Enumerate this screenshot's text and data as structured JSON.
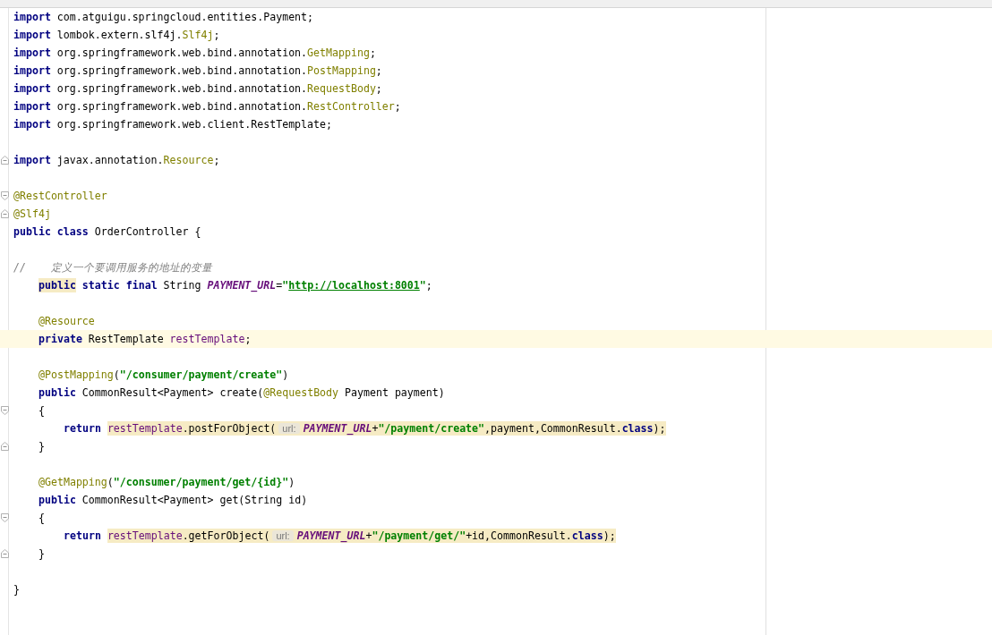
{
  "editor": {
    "lines": [
      {
        "kind": "top",
        "current": false,
        "fold_start": false,
        "fold_end": false,
        "tokens": [
          {
            "kind": "kw",
            "text": "import"
          },
          {
            "kind": "plain",
            "text": " com.atguigu.springcloud.entities.Payment;"
          }
        ]
      },
      {
        "kind": "top",
        "current": false,
        "fold_start": false,
        "fold_end": false,
        "tokens": [
          {
            "kind": "kw",
            "text": "import"
          },
          {
            "kind": "plain",
            "text": " lombok.extern.slf4j."
          },
          {
            "kind": "ann",
            "text": "Slf4j"
          },
          {
            "kind": "plain",
            "text": ";"
          }
        ]
      },
      {
        "kind": "top",
        "current": false,
        "fold_start": false,
        "fold_end": false,
        "tokens": [
          {
            "kind": "kw",
            "text": "import"
          },
          {
            "kind": "plain",
            "text": " org.springframework.web.bind.annotation."
          },
          {
            "kind": "ann",
            "text": "GetMapping"
          },
          {
            "kind": "plain",
            "text": ";"
          }
        ]
      },
      {
        "kind": "top",
        "current": false,
        "fold_start": false,
        "fold_end": false,
        "tokens": [
          {
            "kind": "kw",
            "text": "import"
          },
          {
            "kind": "plain",
            "text": " org.springframework.web.bind.annotation."
          },
          {
            "kind": "ann",
            "text": "PostMapping"
          },
          {
            "kind": "plain",
            "text": ";"
          }
        ]
      },
      {
        "kind": "top",
        "current": false,
        "fold_start": false,
        "fold_end": false,
        "tokens": [
          {
            "kind": "kw",
            "text": "import"
          },
          {
            "kind": "plain",
            "text": " org.springframework.web.bind.annotation."
          },
          {
            "kind": "ann",
            "text": "RequestBody"
          },
          {
            "kind": "plain",
            "text": ";"
          }
        ]
      },
      {
        "kind": "top",
        "current": false,
        "fold_start": false,
        "fold_end": false,
        "tokens": [
          {
            "kind": "kw",
            "text": "import"
          },
          {
            "kind": "plain",
            "text": " org.springframework.web.bind.annotation."
          },
          {
            "kind": "ann",
            "text": "RestController"
          },
          {
            "kind": "plain",
            "text": ";"
          }
        ]
      },
      {
        "kind": "top",
        "current": false,
        "fold_start": false,
        "fold_end": false,
        "tokens": [
          {
            "kind": "kw",
            "text": "import"
          },
          {
            "kind": "plain",
            "text": " org.springframework.web.client.RestTemplate;"
          }
        ]
      },
      {
        "current": false,
        "fold_start": false,
        "fold_end": false
      },
      {
        "kind": "top",
        "current": false,
        "fold_start": false,
        "fold_end": true,
        "tokens": [
          {
            "kind": "kw",
            "text": "import"
          },
          {
            "kind": "plain",
            "text": " javax.annotation."
          },
          {
            "kind": "ann",
            "text": "Resource"
          },
          {
            "kind": "plain",
            "text": ";"
          }
        ]
      },
      {
        "current": false,
        "fold_start": false,
        "fold_end": false
      },
      {
        "kind": "top",
        "current": false,
        "fold_start": true,
        "fold_end": false,
        "tokens": [
          {
            "kind": "ann",
            "text": "@RestController"
          }
        ]
      },
      {
        "kind": "top",
        "current": false,
        "fold_start": false,
        "fold_end": true,
        "tokens": [
          {
            "kind": "ann",
            "text": "@Slf4j"
          }
        ]
      },
      {
        "kind": "top",
        "current": false,
        "fold_start": false,
        "fold_end": false,
        "tokens": [
          {
            "kind": "kw",
            "text": "public class"
          },
          {
            "kind": "plain",
            "text": " OrderController {"
          }
        ]
      },
      {
        "current": false,
        "fold_start": false,
        "fold_end": false
      },
      {
        "kind": "top",
        "current": false,
        "fold_start": false,
        "fold_end": false,
        "tokens": [
          {
            "kind": "comment",
            "text": "//    定义一个要调用服务的地址的变量"
          }
        ]
      },
      {
        "kind": "member",
        "current": false,
        "fold_start": false,
        "fold_end": false,
        "tokens": [
          {
            "kind": "mark",
            "tokens": [
              {
                "kind": "kw",
                "text": "public"
              }
            ]
          },
          {
            "kind": "kw",
            "text": " static final"
          },
          {
            "kind": "plain",
            "text": " String "
          },
          {
            "kind": "field",
            "text": "PAYMENT_URL"
          },
          {
            "kind": "plain",
            "text": "="
          },
          {
            "kind": "str",
            "text": "\""
          },
          {
            "kind": "link",
            "text": "http://localhost:8001"
          },
          {
            "kind": "str",
            "text": "\""
          },
          {
            "kind": "plain",
            "text": ";"
          }
        ]
      },
      {
        "current": false,
        "fold_start": false,
        "fold_end": false
      },
      {
        "kind": "member",
        "current": false,
        "fold_start": false,
        "fold_end": false,
        "tokens": [
          {
            "kind": "ann",
            "text": "@Resource"
          }
        ]
      },
      {
        "kind": "member",
        "current": true,
        "fold_start": false,
        "fold_end": false,
        "tokens": [
          {
            "kind": "kw",
            "text": "private"
          },
          {
            "kind": "plain",
            "text": " RestTemplate "
          },
          {
            "kind": "inst",
            "text": "restTemplate"
          },
          {
            "kind": "plain",
            "text": ";"
          }
        ]
      },
      {
        "current": false,
        "fold_start": false,
        "fold_end": false
      },
      {
        "kind": "member",
        "current": false,
        "fold_start": false,
        "fold_end": false,
        "tokens": [
          {
            "kind": "ann",
            "text": "@PostMapping"
          },
          {
            "kind": "plain",
            "text": "("
          },
          {
            "kind": "str",
            "text": "\"/consumer/payment/create\""
          },
          {
            "kind": "plain",
            "text": ")"
          }
        ]
      },
      {
        "kind": "member",
        "current": false,
        "fold_start": false,
        "fold_end": false,
        "tokens": [
          {
            "kind": "kw",
            "text": "public"
          },
          {
            "kind": "plain",
            "text": " CommonResult<Payment> create("
          },
          {
            "kind": "ann",
            "text": "@RequestBody"
          },
          {
            "kind": "plain",
            "text": " Payment payment)"
          }
        ]
      },
      {
        "kind": "member",
        "current": false,
        "fold_start": true,
        "fold_end": false,
        "tokens": [
          {
            "kind": "plain",
            "text": "{"
          }
        ]
      },
      {
        "kind": "statement",
        "current": false,
        "fold_start": false,
        "fold_end": false,
        "tokens": [
          {
            "kind": "kw",
            "text": "return "
          },
          {
            "kind": "mark",
            "tokens": [
              {
                "kind": "inst",
                "text": "restTemplate"
              },
              {
                "kind": "plain",
                "text": ".postForObject("
              },
              {
                "kind": "hint",
                "text": "url:"
              },
              {
                "kind": "field",
                "text": "PAYMENT_URL"
              },
              {
                "kind": "plain",
                "text": "+"
              },
              {
                "kind": "str",
                "text": "\"/payment/create\""
              },
              {
                "kind": "plain",
                "text": ",payment,CommonResult."
              },
              {
                "kind": "kw",
                "text": "class"
              },
              {
                "kind": "plain",
                "text": ");"
              }
            ]
          }
        ]
      },
      {
        "kind": "member",
        "current": false,
        "fold_start": false,
        "fold_end": true,
        "tokens": [
          {
            "kind": "plain",
            "text": "}"
          }
        ]
      },
      {
        "current": false,
        "fold_start": false,
        "fold_end": false
      },
      {
        "kind": "member",
        "current": false,
        "fold_start": false,
        "fold_end": false,
        "tokens": [
          {
            "kind": "ann",
            "text": "@GetMapping"
          },
          {
            "kind": "plain",
            "text": "("
          },
          {
            "kind": "str",
            "text": "\"/consumer/payment/get/{id}\""
          },
          {
            "kind": "plain",
            "text": ")"
          }
        ]
      },
      {
        "kind": "member",
        "current": false,
        "fold_start": false,
        "fold_end": false,
        "tokens": [
          {
            "kind": "kw",
            "text": "public"
          },
          {
            "kind": "plain",
            "text": " CommonResult<Payment> get(String id)"
          }
        ]
      },
      {
        "kind": "member",
        "current": false,
        "fold_start": true,
        "fold_end": false,
        "tokens": [
          {
            "kind": "plain",
            "text": "{"
          }
        ]
      },
      {
        "kind": "statement",
        "current": false,
        "fold_start": false,
        "fold_end": false,
        "tokens": [
          {
            "kind": "kw",
            "text": "return "
          },
          {
            "kind": "mark",
            "tokens": [
              {
                "kind": "inst",
                "text": "restTemplate"
              },
              {
                "kind": "plain",
                "text": ".getForObject("
              },
              {
                "kind": "hint",
                "text": "url:"
              },
              {
                "kind": "field",
                "text": "PAYMENT_URL"
              },
              {
                "kind": "plain",
                "text": "+"
              },
              {
                "kind": "str",
                "text": "\"/payment/get/\""
              },
              {
                "kind": "plain",
                "text": "+id,CommonResult."
              },
              {
                "kind": "kw",
                "text": "class"
              },
              {
                "kind": "plain",
                "text": ");"
              }
            ]
          }
        ]
      },
      {
        "kind": "member",
        "current": false,
        "fold_start": false,
        "fold_end": true,
        "tokens": [
          {
            "kind": "plain",
            "text": "}"
          }
        ]
      },
      {
        "current": false,
        "fold_start": false,
        "fold_end": false
      },
      {
        "kind": "top",
        "current": false,
        "fold_start": false,
        "fold_end": false,
        "tokens": [
          {
            "kind": "plain",
            "text": "}"
          }
        ]
      }
    ]
  }
}
